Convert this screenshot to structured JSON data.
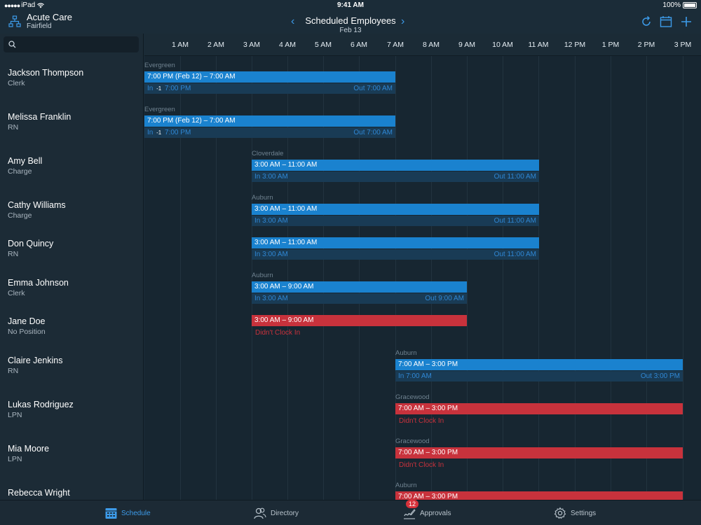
{
  "status_bar": {
    "carrier": "iPad",
    "time": "9:41 AM",
    "battery": "100%"
  },
  "header": {
    "org_title": "Acute Care",
    "org_sub": "Fairfield",
    "title": "Scheduled Employees",
    "date": "Feb 13",
    "prev_icon": "chevron-left-icon",
    "next_icon": "chevron-right-icon",
    "actions": [
      "refresh-icon",
      "calendar-icon",
      "plus-icon"
    ]
  },
  "search": {
    "placeholder": ""
  },
  "hours": [
    "1 AM",
    "2 AM",
    "3 AM",
    "4 AM",
    "5 AM",
    "6 AM",
    "7 AM",
    "8 AM",
    "9 AM",
    "10 AM",
    "11 AM",
    "12 PM",
    "1 PM",
    "2 PM",
    "3 PM"
  ],
  "employees": [
    {
      "name": "Jackson Thompson",
      "position": "Clerk",
      "facility": "Evergreen",
      "shift": "7:00 PM (Feb 12) – 7:00 AM",
      "status": "in",
      "in_label": "In",
      "in_badge": "-1",
      "in_time": "7:00 PM",
      "out_label": "Out",
      "out_time": "7:00 AM"
    },
    {
      "name": "Melissa Franklin",
      "position": "RN",
      "facility": "Evergreen",
      "shift": "7:00 PM (Feb 12) – 7:00 AM",
      "status": "in",
      "in_label": "In",
      "in_badge": "-1",
      "in_time": "7:00 PM",
      "out_label": "Out",
      "out_time": "7:00 AM"
    },
    {
      "name": "Amy Bell",
      "position": "Charge",
      "facility": "Cloverdale",
      "shift": "3:00 AM – 11:00 AM",
      "status": "in",
      "in_label": "In",
      "in_time": "3:00 AM",
      "out_label": "Out",
      "out_time": "11:00 AM"
    },
    {
      "name": "Cathy Williams",
      "position": "Charge",
      "facility": "Auburn",
      "shift": "3:00 AM – 11:00 AM",
      "status": "in",
      "in_label": "In",
      "in_time": "3:00 AM",
      "out_label": "Out",
      "out_time": "11:00 AM"
    },
    {
      "name": "Don Quincy",
      "position": "RN",
      "facility": "",
      "shift": "3:00 AM – 11:00 AM",
      "status": "in",
      "in_label": "In",
      "in_time": "3:00 AM",
      "out_label": "Out",
      "out_time": "11:00 AM"
    },
    {
      "name": "Emma Johnson",
      "position": "Clerk",
      "facility": "Auburn",
      "shift": "3:00 AM – 9:00 AM",
      "status": "in",
      "in_label": "In",
      "in_time": "3:00 AM",
      "out_label": "Out",
      "out_time": "9:00 AM"
    },
    {
      "name": "Jane Doe",
      "position": "No Position",
      "facility": "",
      "shift": "3:00 AM – 9:00 AM",
      "status": "missed",
      "missed_text": "Didn't Clock In"
    },
    {
      "name": "Claire Jenkins",
      "position": "RN",
      "facility": "Auburn",
      "shift": "7:00 AM – 3:00 PM",
      "status": "in",
      "in_label": "In",
      "in_time": "7:00 AM",
      "out_label": "Out",
      "out_time": "3:00 PM"
    },
    {
      "name": "Lukas Rodriguez",
      "position": "LPN",
      "facility": "Gracewood",
      "shift": "7:00 AM – 3:00 PM",
      "status": "missed",
      "missed_text": "Didn't Clock In"
    },
    {
      "name": "Mia Moore",
      "position": "LPN",
      "facility": "Gracewood",
      "shift": "7:00 AM – 3:00 PM",
      "status": "missed",
      "missed_text": "Didn't Clock In"
    },
    {
      "name": "Rebecca Wright",
      "position": "",
      "facility": "Auburn",
      "shift": "7:00 AM – 3:00 PM",
      "status": "missed"
    }
  ],
  "tabs": [
    {
      "label": "Schedule",
      "icon": "calendar-grid-icon",
      "active": true
    },
    {
      "label": "Directory",
      "icon": "people-icon",
      "active": false
    },
    {
      "label": "Approvals",
      "icon": "signature-icon",
      "active": false,
      "badge": "12"
    },
    {
      "label": "Settings",
      "icon": "gear-icon",
      "active": false
    }
  ],
  "colors": {
    "accent": "#3d9be9",
    "shift_blue": "#1a82cf",
    "shift_red": "#c8323c",
    "background": "#1b2c38"
  }
}
